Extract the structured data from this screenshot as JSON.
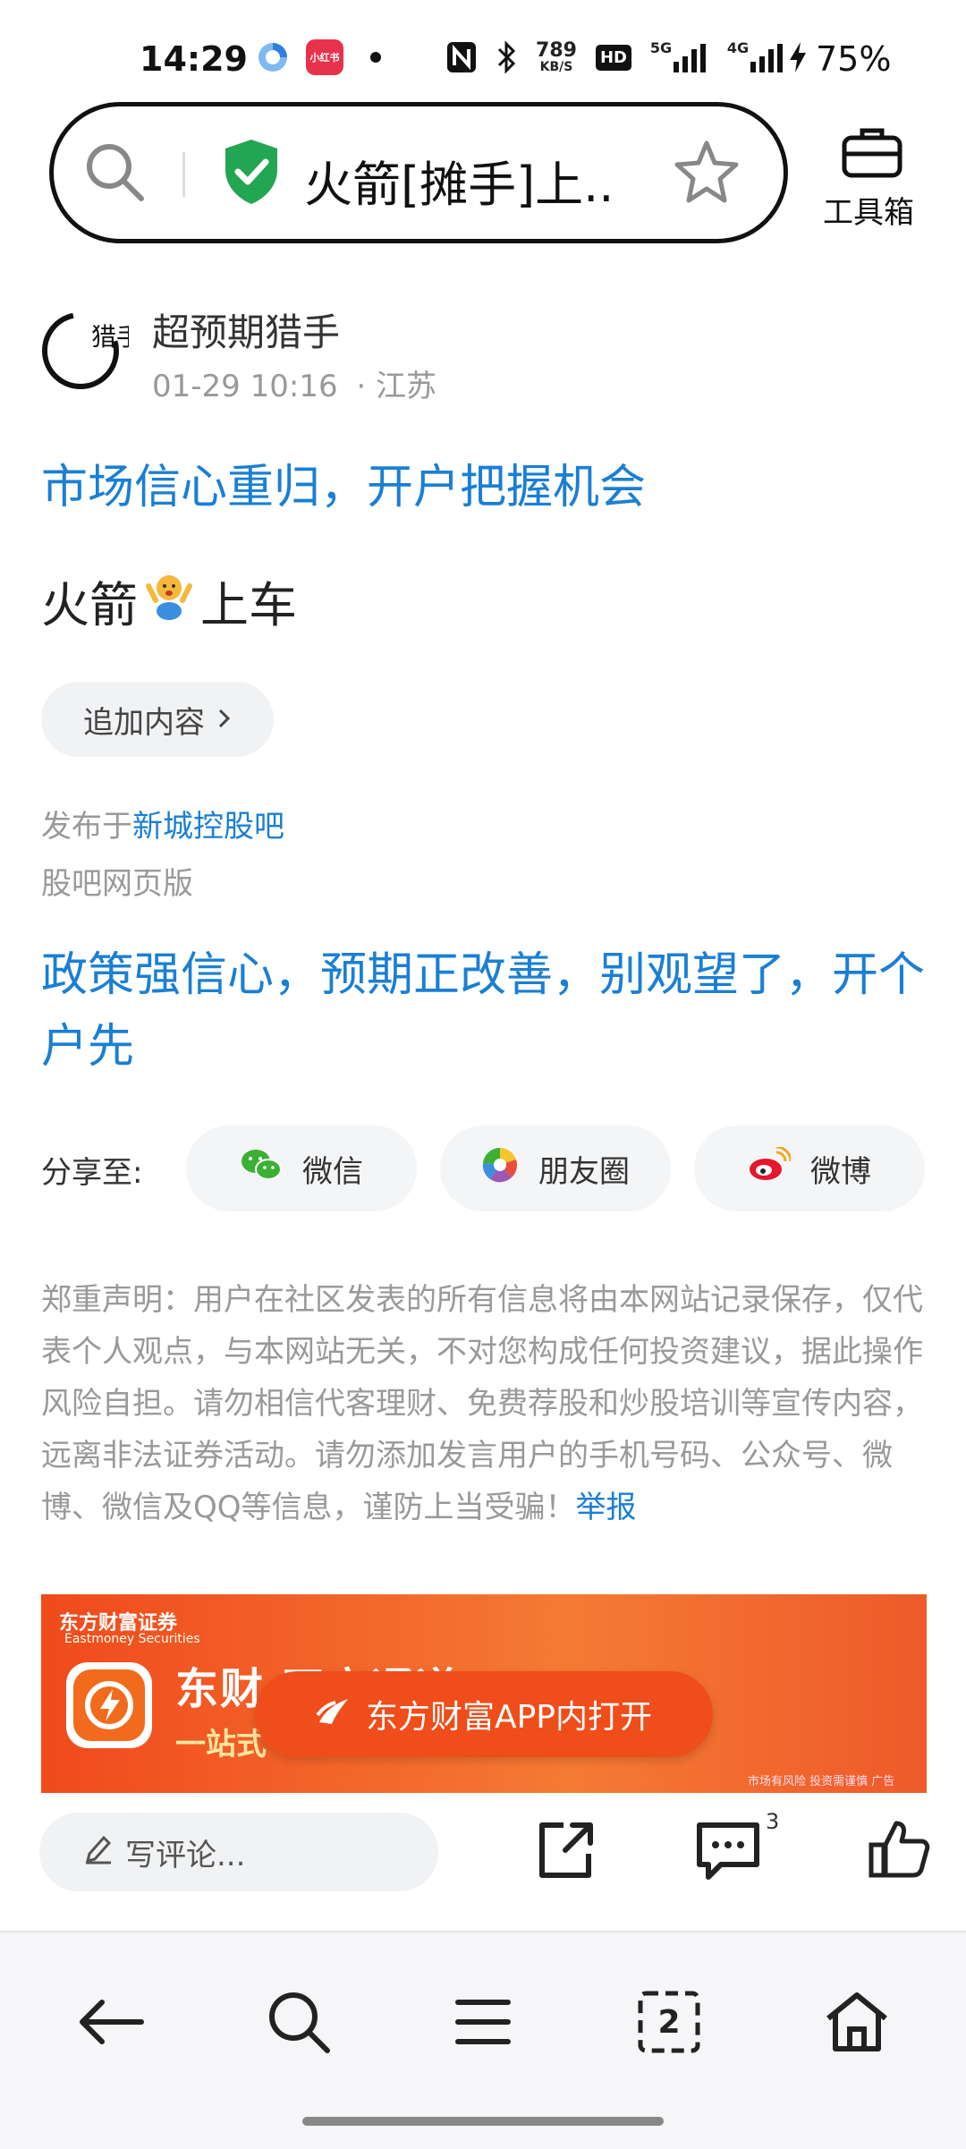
{
  "status_bar": {
    "time": "14:29",
    "speed_value": "789",
    "speed_unit": "KB/S",
    "hd_label": "HD",
    "net_5g": "5G",
    "net_4g": "4G",
    "battery": "75%",
    "xiaohongshu_label": "小红书"
  },
  "address_bar": {
    "title": "火箭[摊手]上...",
    "toolbox_label": "工具箱"
  },
  "post": {
    "author": "超预期猎手",
    "avatar_text": "猎手",
    "time": "01-29 10:16",
    "location": "· 江苏",
    "headline": "市场信心重归，开户把握机会",
    "body_before": "火箭",
    "body_after": "上车",
    "append_label": "追加内容",
    "published_prefix": "发布于",
    "published_forum": "新城控股吧",
    "web_version": "股吧网页版"
  },
  "promo_headline": "政策强信心，预期正改善，别观望了，开个户先",
  "share": {
    "label": "分享至:",
    "wechat": "微信",
    "moments": "朋友圈",
    "weibo": "微博"
  },
  "disclaimer": {
    "text": "郑重声明：用户在社区发表的所有信息将由本网站记录保存，仅代表个人观点，与本网站无关，不对您构成任何投资建议，据此操作风险自担。请勿相信代客理财、免费荐股和炒股培训等宣传内容，远离非法证券活动。请勿添加发言用户的手机号码、公众号、微博、微信及QQ等信息，谨防上当受骗！",
    "report_link": "举报"
  },
  "ad": {
    "brand": "东方财富证券",
    "brand_en": "Eastmoney Securities",
    "main_text": "东财 开户通道",
    "sub_text": "一站式",
    "note": "市场有风险 投资需谨慎 广告",
    "open_app_label": "东方财富APP内打开"
  },
  "comment_bar": {
    "placeholder": "写评论...",
    "comment_count": "3"
  },
  "nav": {
    "tab_count": "2"
  },
  "colors": {
    "link_blue": "#1a7fd4",
    "ad_orange": "#ef4d1a",
    "shield_green": "#22a652"
  }
}
